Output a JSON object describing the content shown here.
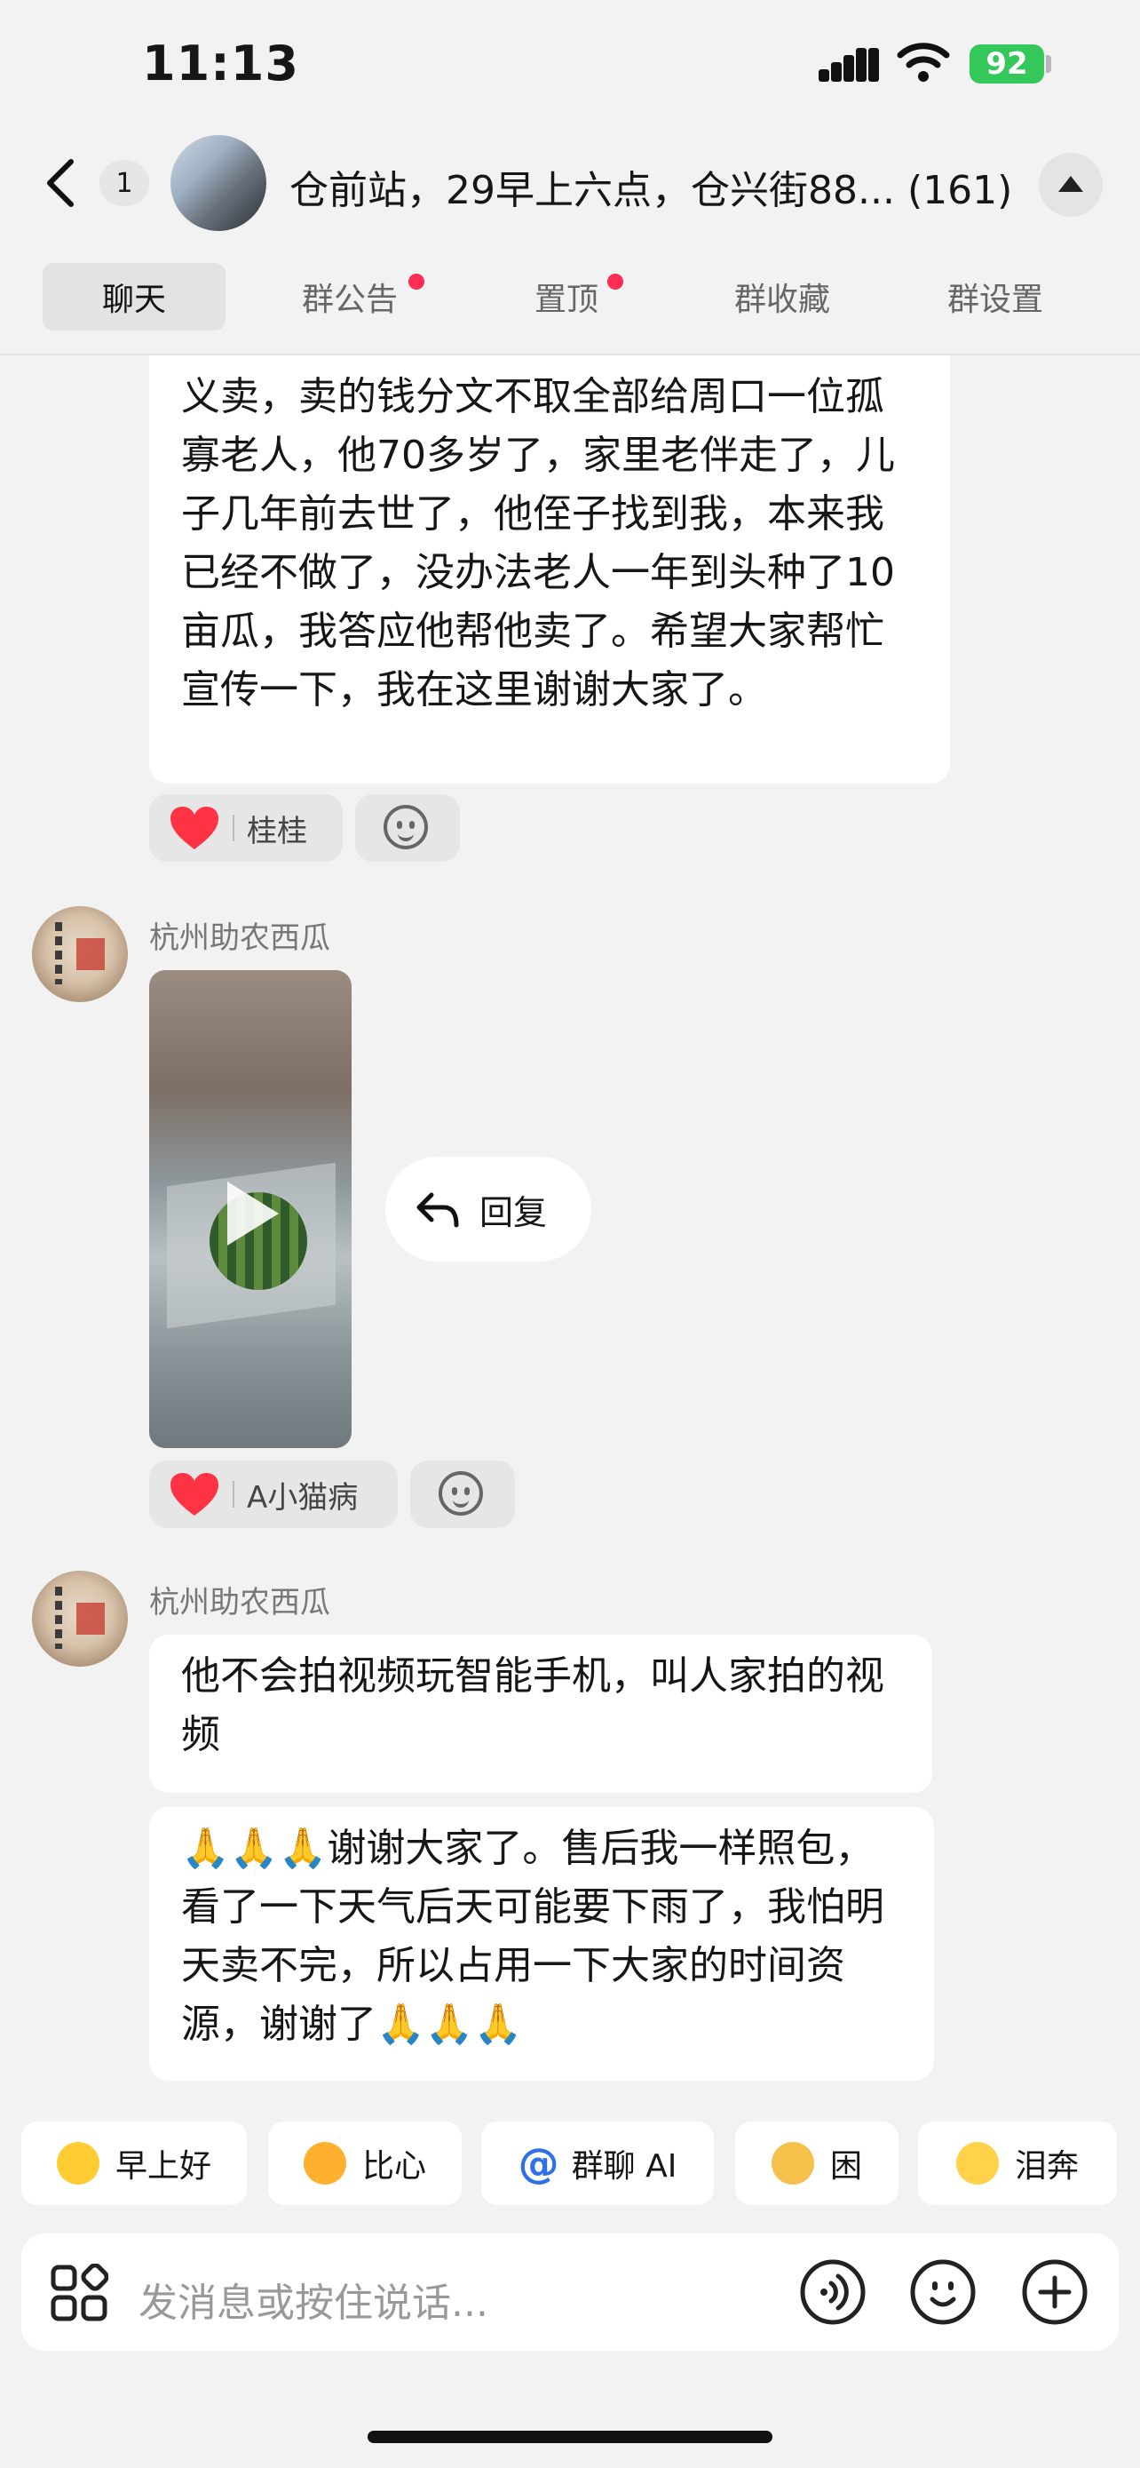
{
  "status_bar": {
    "time": "11:13",
    "battery": "92"
  },
  "header": {
    "back_icon": "chevron-left-icon",
    "unread_count": "1",
    "title": "仓前站，29早上六点，仓兴街88...",
    "member_count": "(161)"
  },
  "tabs": [
    {
      "label": "聊天",
      "active": true,
      "dot": false
    },
    {
      "label": "群公告",
      "active": false,
      "dot": true
    },
    {
      "label": "置顶",
      "active": false,
      "dot": true
    },
    {
      "label": "群收藏",
      "active": false,
      "dot": false
    },
    {
      "label": "群设置",
      "active": false,
      "dot": false
    }
  ],
  "messages": {
    "m1": {
      "text": "义卖，卖的钱分文不取全部给周口一位孤寡老人，他70多岁了，家里老伴走了，儿子几年前去世了，他侄子找到我，本来我已经不做了，没办法老人一年到头种了10亩瓜，我答应他帮他卖了。希望大家帮忙宣传一下，我在这里谢谢大家了。",
      "reaction_user": "桂桂"
    },
    "m2": {
      "sender": "杭州助农西瓜",
      "type": "video",
      "reaction_user": "A小猫病",
      "reply_label": "回复"
    },
    "m3": {
      "sender": "杭州助农西瓜",
      "text_a": "他不会拍视频玩智能手机，叫人家拍的视频",
      "text_b": "🙏🙏🙏谢谢大家了。售后我一样照包，看了一下天气后天可能要下雨了，我怕明天卖不完，所以占用一下大家的时间资源，谢谢了🙏🙏🙏"
    }
  },
  "quick_replies": [
    "早上好",
    "比心",
    "群聊 AI",
    "困",
    "泪奔"
  ],
  "input": {
    "placeholder": "发消息或按住说话..."
  },
  "colors": {
    "accent_red": "#ff2d55",
    "battery_green": "#34c759",
    "ai_blue": "#2f6fe8"
  }
}
